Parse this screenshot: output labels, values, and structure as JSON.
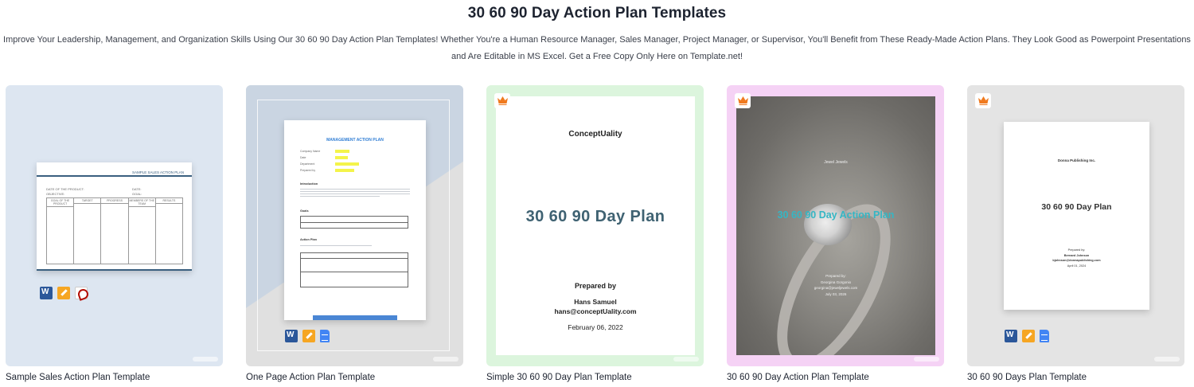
{
  "header": {
    "title": "30 60 90 Day Action Plan Templates",
    "description": "Improve Your Leadership, Management, and Organization Skills Using Our 30 60 90 Day Action Plan Templates! Whether You're a Human Resource Manager, Sales Manager, Project Manager, or Supervisor, You'll Benefit from These Ready-Made Action Plans. They Look Good as Powerpoint Presentations and Are Editable in MS Excel. Get a Free Copy Only Here on Template.net!"
  },
  "colors": {
    "card1_bg": "#dde6f1",
    "card2_bg": "#e0e0e0",
    "card3_bg": "#dcf5dd",
    "card4_bg": "#f5d2f5",
    "card5_bg": "#e4e4e4",
    "crown": "#f07a1f"
  },
  "cards": [
    {
      "caption": "Sample Sales Action Plan Template",
      "premium": false,
      "formats": [
        "word-icon",
        "pages-icon",
        "pdf-icon"
      ],
      "preview": {
        "heading": "SAMPLE SALES ACTION PLAN",
        "columns": [
          "GOAL OF THE PRODUCT",
          "TARGET",
          "PROGRESS",
          "MEMBERS OF THE TEAM",
          "RESULTS"
        ]
      }
    },
    {
      "caption": "One Page Action Plan Template",
      "premium": false,
      "formats": [
        "word-icon",
        "pages-icon",
        "google-docs-icon"
      ],
      "preview": {
        "heading": "MANAGEMENT ACTION PLAN",
        "fields": [
          "Company Name",
          "Date",
          "Department",
          "Prepared by"
        ],
        "sections": [
          "Introduction",
          "Goals",
          "Action Plan"
        ]
      }
    },
    {
      "caption": "Simple 30 60 90 Day Plan Template",
      "premium": true,
      "formats": [],
      "preview": {
        "brand": "ConceptUality",
        "title": "30 60 90 Day Plan",
        "prepared_by_label": "Prepared by",
        "name": "Hans Samuel",
        "email": "hans@conceptUality.com",
        "date": "February 06, 2022"
      }
    },
    {
      "caption": "30 60 90 Day Action Plan Template",
      "premium": true,
      "formats": [],
      "preview": {
        "brand": "Jewel Jewels",
        "title": "30 60 90 Day Action Plan",
        "prepared_by_label": "Prepared by:",
        "name": "Georgina Gorgonio",
        "email": "georgina@jeweljewels.com",
        "date": "July 03, 2026"
      }
    },
    {
      "caption": "30 60 90 Days Plan Template",
      "premium": true,
      "formats": [
        "word-icon",
        "pages-icon",
        "google-docs-icon"
      ],
      "preview": {
        "brand": "Donna Publishing Inc.",
        "title": "30 60 90 Day Plan",
        "prepared_by_label": "Prepared by:",
        "name": "Bernard Johnson",
        "email": "bjohnson@donnapublishing.com",
        "date": "April 01, 2024"
      }
    }
  ]
}
